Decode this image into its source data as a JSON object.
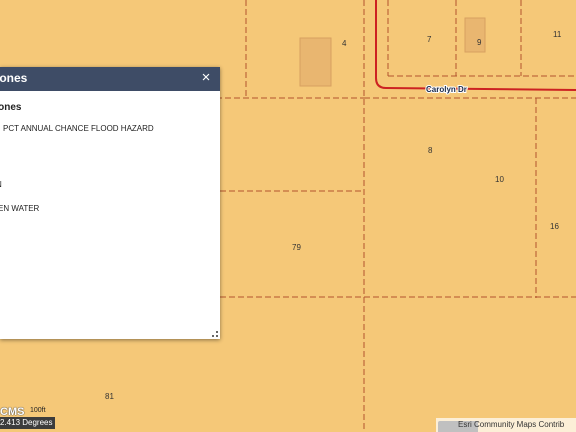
{
  "map": {
    "road": {
      "name": "Carolyn Dr",
      "color": "#cc2222"
    },
    "parcel_labels": [
      "4",
      "7",
      "9",
      "11",
      "8",
      "10",
      "16",
      "79",
      "81"
    ],
    "fill_color": "#f5c878",
    "boundary_color": "#b2542e"
  },
  "popup": {
    "title": "Zones",
    "close_glyph": "×",
    "subtitle": "Zones",
    "rows": [
      "PCT ANNUAL CHANCE FLOOD HAZARD",
      "",
      "N",
      "EN WATER",
      "",
      "",
      ""
    ]
  },
  "scale": {
    "label": "CMS",
    "unit": "100ft"
  },
  "coordinates": {
    "text": "2.413 Degrees"
  },
  "attribution": {
    "text": "Esri Community Maps Contrib"
  }
}
